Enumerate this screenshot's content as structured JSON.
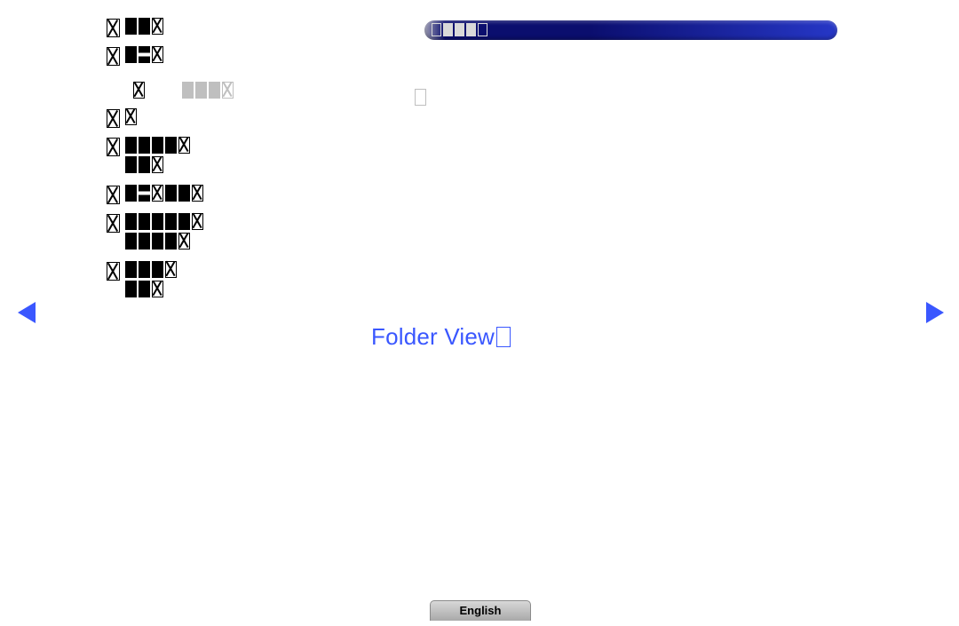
{
  "nav": {
    "items": [
      {
        "id": "item-1",
        "glyphs": [
          "blk",
          "blk",
          "outline-x"
        ]
      },
      {
        "id": "item-2",
        "glyphs": [
          "blk",
          "blk-notch",
          "outline-x"
        ]
      },
      {
        "id": "item-3",
        "glyphs": [
          "outline-x"
        ]
      },
      {
        "id": "item-4",
        "glyphs": [
          "blk",
          "blk",
          "blk",
          "blk",
          "outline-x",
          "br",
          "blk",
          "blk",
          "outline-x"
        ]
      },
      {
        "id": "item-5",
        "glyphs": [
          "blk",
          "blk-notch",
          "outline-x",
          "blk",
          "blk",
          "outline-x"
        ]
      },
      {
        "id": "item-6",
        "glyphs": [
          "blk",
          "blk",
          "blk",
          "blk",
          "blk",
          "outline-x",
          "br",
          "blk",
          "blk",
          "blk",
          "blk",
          "outline-x"
        ]
      },
      {
        "id": "item-7",
        "glyphs": [
          "blk",
          "blk",
          "blk",
          "outline-x",
          "br",
          "blk",
          "blk",
          "outline-x"
        ]
      }
    ],
    "sub_item": {
      "after_index": 1,
      "glyphs_left": [
        "outline-x"
      ],
      "glyphs_right": [
        "blk-grey",
        "blk-grey",
        "blk-grey",
        "outline-x-grey"
      ]
    }
  },
  "pill": {
    "glyphs": [
      "outline-lgrey",
      "blk-lgrey",
      "blk-lgrey",
      "blk-lgrey",
      "outline-lgrey"
    ]
  },
  "main": {
    "folder_view_label": "Folder View"
  },
  "footer": {
    "language_label": "English"
  }
}
